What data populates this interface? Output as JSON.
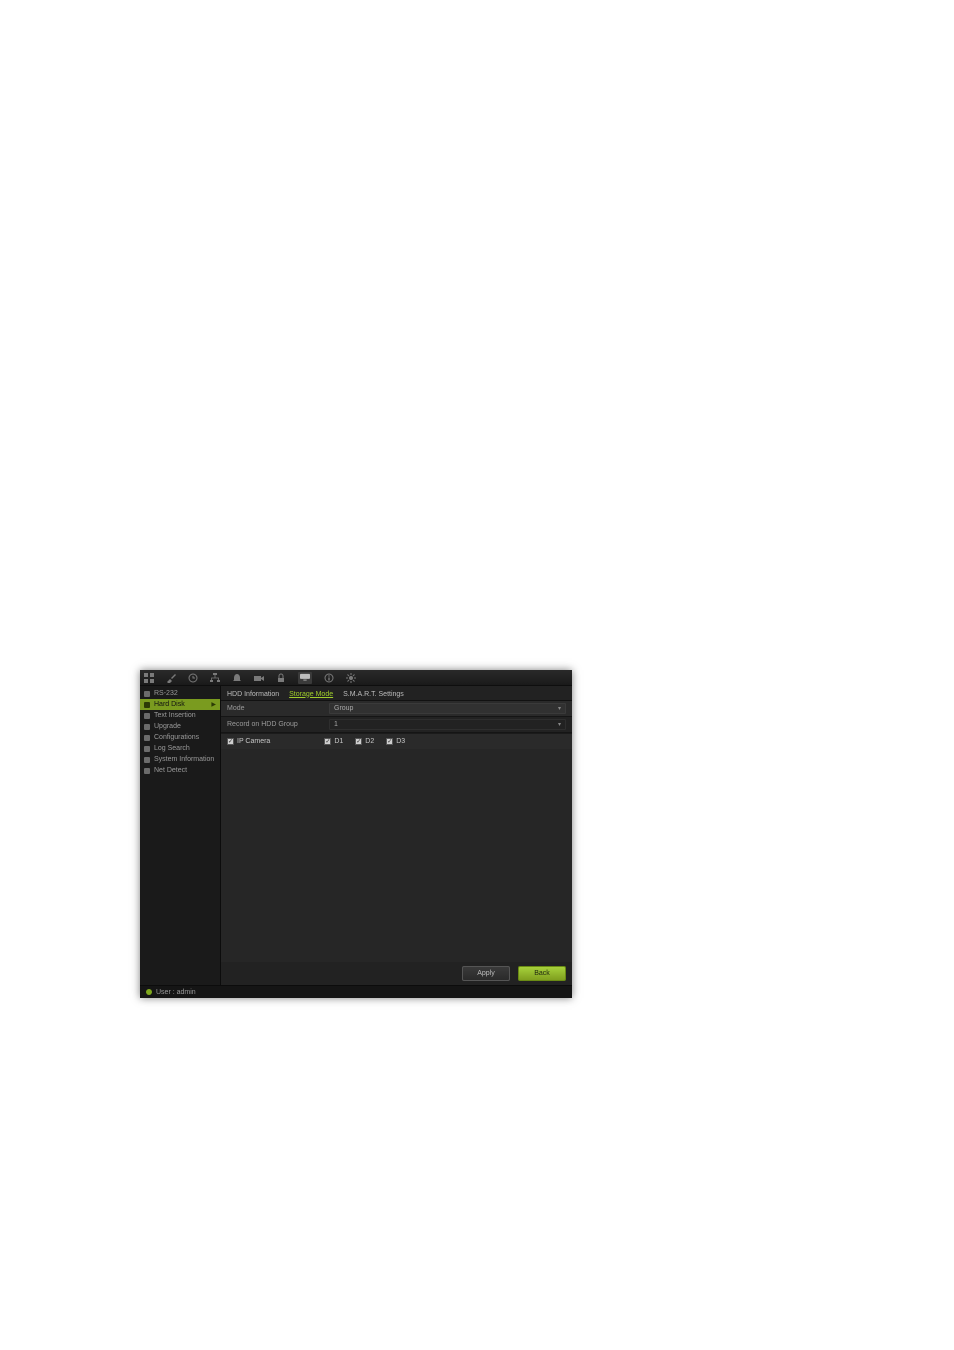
{
  "toolbar": {
    "icons": [
      "grid-icon",
      "brush-icon",
      "clock-icon",
      "tree-icon",
      "bell-icon",
      "camera-icon",
      "lock-icon",
      "screen-icon",
      "info-icon",
      "gear-icon"
    ],
    "active_index": 7
  },
  "sidebar": {
    "items": [
      {
        "icon": "serial-icon",
        "label": "RS-232"
      },
      {
        "icon": "hdd-icon",
        "label": "Hard Disk",
        "active": true
      },
      {
        "icon": "text-icon",
        "label": "Text Insertion"
      },
      {
        "icon": "upgrade-icon",
        "label": "Upgrade"
      },
      {
        "icon": "config-icon",
        "label": "Configurations"
      },
      {
        "icon": "log-icon",
        "label": "Log Search"
      },
      {
        "icon": "info-icon",
        "label": "System Information"
      },
      {
        "icon": "net-icon",
        "label": "Net Detect"
      }
    ]
  },
  "tabs": [
    {
      "label": "HDD Information"
    },
    {
      "label": "Storage Mode",
      "active": true
    },
    {
      "label": "S.M.A.R.T. Settings"
    }
  ],
  "form": {
    "mode_label": "Mode",
    "mode_value": "Group",
    "record_group_label": "Record on HDD Group",
    "record_group_value": "1"
  },
  "cameras": {
    "master_label": "IP Camera",
    "items": [
      {
        "label": "D1",
        "checked": true
      },
      {
        "label": "D2",
        "checked": true
      },
      {
        "label": "D3",
        "checked": true
      }
    ]
  },
  "actions": {
    "apply": "Apply",
    "back": "Back"
  },
  "status": {
    "user_label": "User : admin"
  }
}
